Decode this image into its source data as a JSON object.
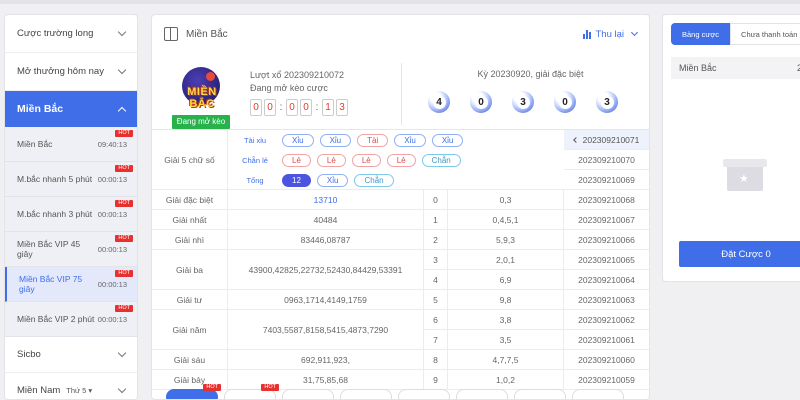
{
  "sidebar": {
    "long_bets": "Cược trường long",
    "open_today": "Mở thưởng hôm nay",
    "active_region": "Miền Bắc",
    "games": [
      {
        "name": "Miền Bắc",
        "time": "09:40:13",
        "hot": "HOT"
      },
      {
        "name": "M.bắc nhanh 5 phút",
        "time": "00:00:13",
        "hot": "HOT"
      },
      {
        "name": "M.bắc nhanh 3 phút",
        "time": "00:00:13",
        "hot": "HOT"
      },
      {
        "name": "Miền Bắc VIP 45 giây",
        "time": "00:00:13",
        "hot": "HOT"
      },
      {
        "name": "Miền Bắc VIP 75 giây",
        "time": "00:00:13",
        "hot": "HOT"
      },
      {
        "name": "Miền Bắc VIP 2 phút",
        "time": "00:00:13",
        "hot": "HOT"
      }
    ],
    "sicbo": "Sicbo",
    "south": "Miền Nam",
    "south_day": "Thứ 5 ▾"
  },
  "main": {
    "title": "Miền Bắc",
    "history_link": "Thu lại",
    "logo_text": "MIỀN BẮC",
    "status_badge": "Đang mở kèo",
    "draw_period": "Lượt xổ 202309210072",
    "draw_status": "Đang mở kèo cược",
    "countdown": [
      "0",
      "0",
      "0",
      "0",
      "1",
      "3"
    ],
    "special_label": "Kỳ 20230920, giải đặc biệt",
    "special_balls": [
      "4",
      "0",
      "3",
      "0",
      "3"
    ]
  },
  "five_digit": {
    "label": "Giải 5 chữ số",
    "taixiu_label": "Tài xỉu",
    "taixiu": [
      {
        "text": "Xỉu",
        "tone": "blue"
      },
      {
        "text": "Xỉu",
        "tone": "blue"
      },
      {
        "text": "Tài",
        "tone": "red"
      },
      {
        "text": "Xỉu",
        "tone": "blue"
      },
      {
        "text": "Xỉu",
        "tone": "blue"
      }
    ],
    "chanle_label": "Chẵn lẻ",
    "chanle": [
      {
        "text": "Lẻ",
        "tone": "red"
      },
      {
        "text": "Lẻ",
        "tone": "red"
      },
      {
        "text": "Lẻ",
        "tone": "red"
      },
      {
        "text": "Lẻ",
        "tone": "red"
      },
      {
        "text": "Chẵn",
        "tone": "teal"
      }
    ],
    "tong_label": "Tổng",
    "tong": [
      {
        "text": "12",
        "tone": "filled"
      },
      {
        "text": "Xỉu",
        "tone": "blue"
      },
      {
        "text": "Chẵn",
        "tone": "teal"
      }
    ]
  },
  "results": [
    {
      "label": "Giải đặc biệt",
      "numbers": "13710"
    },
    {
      "label": "Giải nhất",
      "numbers": "40484"
    },
    {
      "label": "Giải nhì",
      "numbers": "83446,08787"
    },
    {
      "label": "Giải ba",
      "numbers": "43900,42825,22732,52430,84429,53391"
    },
    {
      "label": "Giải tư",
      "numbers": "0963,1714,4149,1759"
    },
    {
      "label": "Giải năm",
      "numbers": "7403,5587,8158,5415,4873,7290"
    },
    {
      "label": "Giải sáu",
      "numbers": "692,911,923,"
    },
    {
      "label": "Giải bảy",
      "numbers": "31,75,85,68"
    }
  ],
  "heads": [
    {
      "key": "0",
      "tail": "0,3"
    },
    {
      "key": "1",
      "tail": "0,4,5,1"
    },
    {
      "key": "2",
      "tail": "5,9,3"
    },
    {
      "key": "3",
      "tail": "2,0,1"
    },
    {
      "key": "4",
      "tail": "6,9"
    },
    {
      "key": "5",
      "tail": "9,8"
    },
    {
      "key": "6",
      "tail": "3,8"
    },
    {
      "key": "7",
      "tail": "3,5"
    },
    {
      "key": "8",
      "tail": "4,7,7,5"
    },
    {
      "key": "9",
      "tail": "1,0,2"
    }
  ],
  "periods": [
    "202309210071",
    "202309210070",
    "202309210069",
    "202309210068",
    "202309210067",
    "202309210066",
    "202309210065",
    "202309210064",
    "202309210063",
    "202309210062",
    "202309210061",
    "202309210060",
    "202309210059"
  ],
  "bottom_tabs": [
    {
      "hot": "HOT"
    },
    {
      "hot": "HOT"
    },
    {
      "hot": ""
    },
    {
      "hot": ""
    },
    {
      "hot": ""
    },
    {
      "hot": ""
    },
    {
      "hot": ""
    },
    {
      "hot": ""
    }
  ],
  "right_panel": {
    "tab_bets": "Bảng cược",
    "tab_unpaid": "Chưa thanh toán",
    "region": "Miền Bắc",
    "region_value": "2",
    "bet_button": "Đặt Cược 0"
  },
  "colors": {
    "accent": "#3f6ee8",
    "hot": "#e8312f",
    "open": "#27b24b",
    "countdown": "#e23b2e"
  }
}
